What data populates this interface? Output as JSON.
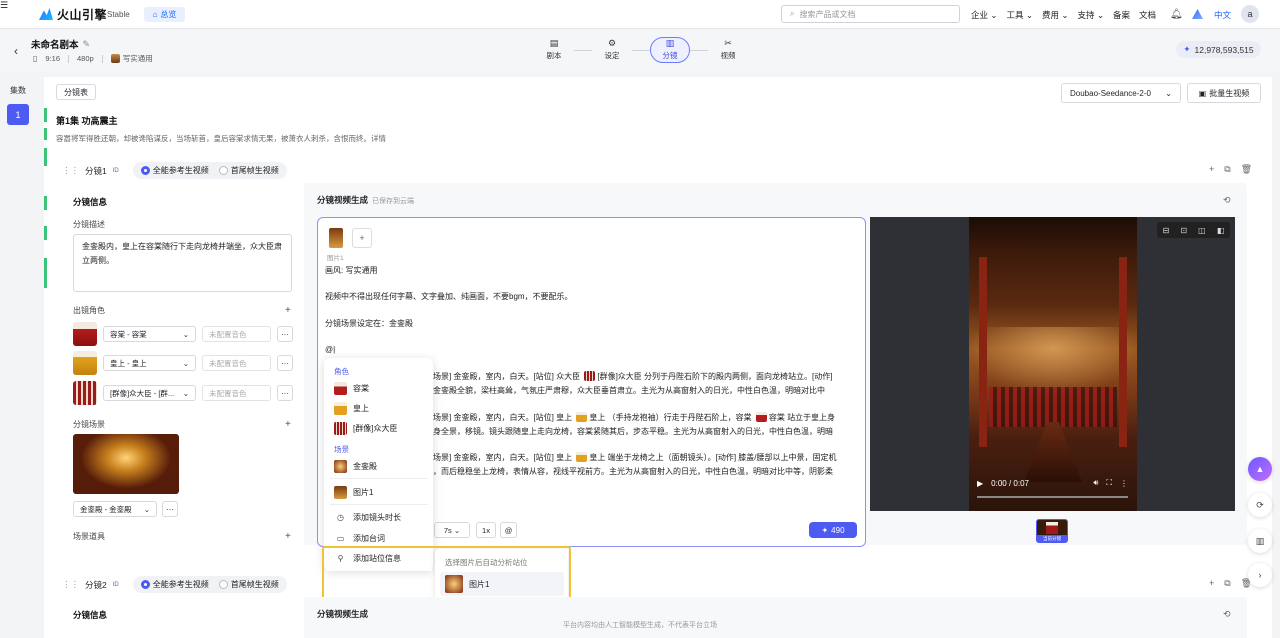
{
  "topnav": {
    "brand": "火山引擎",
    "stable": "Stable",
    "overview": "总览",
    "search_placeholder": "搜索产品或文档",
    "links": [
      "企业 ⌄",
      "工具 ⌄",
      "费用 ⌄",
      "支持 ⌄",
      "备案",
      "文档"
    ],
    "lang": "中文",
    "avatar": "a"
  },
  "header": {
    "title": "未命名剧本",
    "ratio": "9:16",
    "resolution": "480p",
    "style": "写实通用",
    "steps": [
      {
        "label": "剧本",
        "icon": "▤"
      },
      {
        "label": "设定",
        "icon": "⚙"
      },
      {
        "label": "分镜",
        "icon": "▥"
      },
      {
        "label": "视频",
        "icon": "✂"
      }
    ],
    "credits": "12,978,593,515"
  },
  "sidebar": {
    "label": "集数",
    "episode": "1"
  },
  "toolbar": {
    "storyboard_btn": "分镜表",
    "model": "Doubao-Seedance-2-0",
    "batch_btn": "批量生视频"
  },
  "episode": {
    "title": "第1集  功高震主",
    "desc": "容嚣将军得胜还朝，却被谗陷谋反，当场斩首，皇后容棠求情无果，被萧衣人刺杀，含恨而终。详情"
  },
  "shot1": {
    "name": "分镜1",
    "id": "ID",
    "mode1": "全能参考生视频",
    "mode2": "首尾帧生视频",
    "info_title": "分镜信息",
    "desc_label": "分镜描述",
    "desc": "金銮殿内，皇上在容棠随行下走向龙椅并端坐，众大臣肃立两侧。",
    "roles_label": "出镜角色",
    "roles": [
      {
        "name": "容棠 - 容棠",
        "voice": "未配置音色"
      },
      {
        "name": "皇上 - 皇上",
        "voice": "未配置音色"
      },
      {
        "name": "[群像]众大臣 - [群...",
        "voice": "未配置音色"
      }
    ],
    "scene_label": "分镜场景",
    "scene": "金銮殿 - 金銮殿",
    "props_label": "场景道具",
    "gen_title": "分镜视频生成",
    "gen_saved": "已保存到云端",
    "thumb_label": "图片1",
    "lines": {
      "style": "画风: 写实通用",
      "rule": "视频中不得出现任何字幕、文字叠加、纯画面，不要bgm，不要配乐。",
      "scene_prefix": "分镜场景设定在：金銮殿",
      "scene_chip": "金銮殿",
      "at": "@|",
      "p1a": "场景] 金銮殿，室内，白天。[站位] 众大臣",
      "p1chip": "[群像]众大臣",
      "p1b": "分列于丹陛石阶下的殿内两侧，面向龙椅站立。[动作]",
      "p1c": "金銮殿全貌，梁柱高耸，气氛庄严肃穆，众大臣垂首肃立。主光为从高窗射入的日光，中性白色温，明暗对比中",
      "p2a": "场景] 金銮殿，室内，白天。[站位] 皇上",
      "p2chip": "皇上",
      "p2b": "（手持龙袍袖）行走于丹陛石阶上，容棠",
      "p2chip2": "容棠",
      "p2c": "站立于皇上身",
      "p2d": "身全景，移镜。镜头跟随皇上走向龙椅，容棠紧随其后，步态平稳。主光为从高窗射入的日光，中性白色温，明暗",
      "p3a": "场景] 金銮殿，室内，白天。[站位] 皇上",
      "p3chip": "皇上",
      "p3b": "端坐于龙椅之上（面朝镜头）。[动作] 膝盖/腰部以上中景，固定机",
      "p3c": "，而后稳稳坐上龙椅，表情从容，视线平视前方。主光为从高窗射入的日光，中性白色温，明暗对比中等，阴影柔"
    },
    "duration": "7s ⌄",
    "speed": "1x",
    "at_btn": "@",
    "gen_cost": "490",
    "video_time": "0:00 / 0:07",
    "vthumb_tag": "当前分镜"
  },
  "dropdown": {
    "group_roles": "角色",
    "roles": [
      "容棠",
      "皇上",
      "[群像]众大臣"
    ],
    "group_scene": "场景",
    "scenes": [
      "金銮殿"
    ],
    "image": "图片1",
    "actions": [
      "添加镜头时长",
      "添加台词",
      "添加站位信息"
    ],
    "sub_title": "选择图片后自动分析站位",
    "sub_item": "图片1"
  },
  "shot2": {
    "name": "分镜2",
    "id": "ID",
    "mode1": "全能参考生视频",
    "mode2": "首尾帧生视频",
    "info_title": "分镜信息",
    "gen_title": "分镜视频生成"
  },
  "footer": "平台内容均由人工智能模型生成，不代表平台立场",
  "colors": {
    "accent": "#4e5bf2",
    "highlight": "#f1c232",
    "episode_bar": "#3cc37a"
  }
}
